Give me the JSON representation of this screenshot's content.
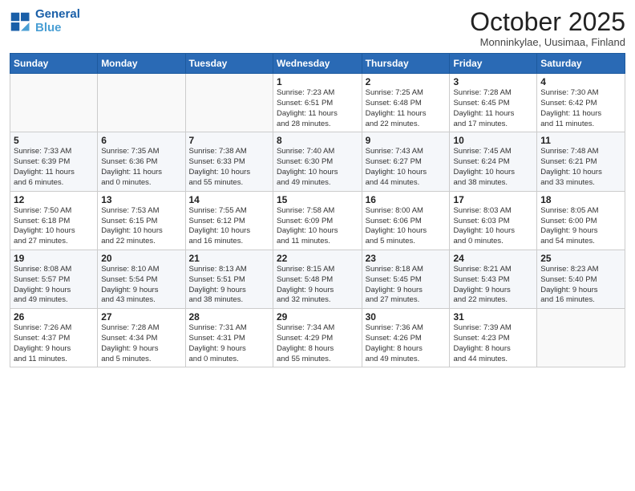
{
  "header": {
    "logo_line1": "General",
    "logo_line2": "Blue",
    "month": "October 2025",
    "location": "Monninkylae, Uusimaa, Finland"
  },
  "weekdays": [
    "Sunday",
    "Monday",
    "Tuesday",
    "Wednesday",
    "Thursday",
    "Friday",
    "Saturday"
  ],
  "weeks": [
    [
      {
        "day": "",
        "info": ""
      },
      {
        "day": "",
        "info": ""
      },
      {
        "day": "",
        "info": ""
      },
      {
        "day": "1",
        "info": "Sunrise: 7:23 AM\nSunset: 6:51 PM\nDaylight: 11 hours\nand 28 minutes."
      },
      {
        "day": "2",
        "info": "Sunrise: 7:25 AM\nSunset: 6:48 PM\nDaylight: 11 hours\nand 22 minutes."
      },
      {
        "day": "3",
        "info": "Sunrise: 7:28 AM\nSunset: 6:45 PM\nDaylight: 11 hours\nand 17 minutes."
      },
      {
        "day": "4",
        "info": "Sunrise: 7:30 AM\nSunset: 6:42 PM\nDaylight: 11 hours\nand 11 minutes."
      }
    ],
    [
      {
        "day": "5",
        "info": "Sunrise: 7:33 AM\nSunset: 6:39 PM\nDaylight: 11 hours\nand 6 minutes."
      },
      {
        "day": "6",
        "info": "Sunrise: 7:35 AM\nSunset: 6:36 PM\nDaylight: 11 hours\nand 0 minutes."
      },
      {
        "day": "7",
        "info": "Sunrise: 7:38 AM\nSunset: 6:33 PM\nDaylight: 10 hours\nand 55 minutes."
      },
      {
        "day": "8",
        "info": "Sunrise: 7:40 AM\nSunset: 6:30 PM\nDaylight: 10 hours\nand 49 minutes."
      },
      {
        "day": "9",
        "info": "Sunrise: 7:43 AM\nSunset: 6:27 PM\nDaylight: 10 hours\nand 44 minutes."
      },
      {
        "day": "10",
        "info": "Sunrise: 7:45 AM\nSunset: 6:24 PM\nDaylight: 10 hours\nand 38 minutes."
      },
      {
        "day": "11",
        "info": "Sunrise: 7:48 AM\nSunset: 6:21 PM\nDaylight: 10 hours\nand 33 minutes."
      }
    ],
    [
      {
        "day": "12",
        "info": "Sunrise: 7:50 AM\nSunset: 6:18 PM\nDaylight: 10 hours\nand 27 minutes."
      },
      {
        "day": "13",
        "info": "Sunrise: 7:53 AM\nSunset: 6:15 PM\nDaylight: 10 hours\nand 22 minutes."
      },
      {
        "day": "14",
        "info": "Sunrise: 7:55 AM\nSunset: 6:12 PM\nDaylight: 10 hours\nand 16 minutes."
      },
      {
        "day": "15",
        "info": "Sunrise: 7:58 AM\nSunset: 6:09 PM\nDaylight: 10 hours\nand 11 minutes."
      },
      {
        "day": "16",
        "info": "Sunrise: 8:00 AM\nSunset: 6:06 PM\nDaylight: 10 hours\nand 5 minutes."
      },
      {
        "day": "17",
        "info": "Sunrise: 8:03 AM\nSunset: 6:03 PM\nDaylight: 10 hours\nand 0 minutes."
      },
      {
        "day": "18",
        "info": "Sunrise: 8:05 AM\nSunset: 6:00 PM\nDaylight: 9 hours\nand 54 minutes."
      }
    ],
    [
      {
        "day": "19",
        "info": "Sunrise: 8:08 AM\nSunset: 5:57 PM\nDaylight: 9 hours\nand 49 minutes."
      },
      {
        "day": "20",
        "info": "Sunrise: 8:10 AM\nSunset: 5:54 PM\nDaylight: 9 hours\nand 43 minutes."
      },
      {
        "day": "21",
        "info": "Sunrise: 8:13 AM\nSunset: 5:51 PM\nDaylight: 9 hours\nand 38 minutes."
      },
      {
        "day": "22",
        "info": "Sunrise: 8:15 AM\nSunset: 5:48 PM\nDaylight: 9 hours\nand 32 minutes."
      },
      {
        "day": "23",
        "info": "Sunrise: 8:18 AM\nSunset: 5:45 PM\nDaylight: 9 hours\nand 27 minutes."
      },
      {
        "day": "24",
        "info": "Sunrise: 8:21 AM\nSunset: 5:43 PM\nDaylight: 9 hours\nand 22 minutes."
      },
      {
        "day": "25",
        "info": "Sunrise: 8:23 AM\nSunset: 5:40 PM\nDaylight: 9 hours\nand 16 minutes."
      }
    ],
    [
      {
        "day": "26",
        "info": "Sunrise: 7:26 AM\nSunset: 4:37 PM\nDaylight: 9 hours\nand 11 minutes."
      },
      {
        "day": "27",
        "info": "Sunrise: 7:28 AM\nSunset: 4:34 PM\nDaylight: 9 hours\nand 5 minutes."
      },
      {
        "day": "28",
        "info": "Sunrise: 7:31 AM\nSunset: 4:31 PM\nDaylight: 9 hours\nand 0 minutes."
      },
      {
        "day": "29",
        "info": "Sunrise: 7:34 AM\nSunset: 4:29 PM\nDaylight: 8 hours\nand 55 minutes."
      },
      {
        "day": "30",
        "info": "Sunrise: 7:36 AM\nSunset: 4:26 PM\nDaylight: 8 hours\nand 49 minutes."
      },
      {
        "day": "31",
        "info": "Sunrise: 7:39 AM\nSunset: 4:23 PM\nDaylight: 8 hours\nand 44 minutes."
      },
      {
        "day": "",
        "info": ""
      }
    ]
  ]
}
